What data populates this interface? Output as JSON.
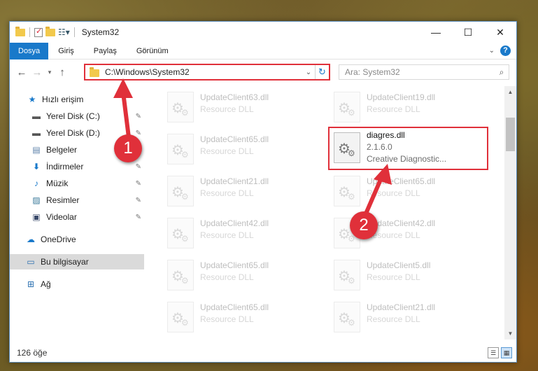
{
  "window": {
    "title": "System32",
    "controls": {
      "minimize": "—",
      "maximize": "☐",
      "close": "✕"
    }
  },
  "ribbon": {
    "tabs": [
      "Dosya",
      "Giriş",
      "Paylaş",
      "Görünüm"
    ]
  },
  "address": {
    "path": "C:\\Windows\\System32",
    "search_placeholder": "Ara: System32"
  },
  "sidebar": {
    "items": [
      {
        "label": "Hızlı erişim",
        "icon": "star-icon"
      },
      {
        "label": "Yerel Disk (C:)",
        "icon": "drive-icon",
        "pinned": true
      },
      {
        "label": "Yerel Disk (D:)",
        "icon": "drive-icon",
        "pinned": true
      },
      {
        "label": "Belgeler",
        "icon": "documents-icon",
        "pinned": true
      },
      {
        "label": "İndirmeler",
        "icon": "download-icon",
        "pinned": true
      },
      {
        "label": "Müzik",
        "icon": "music-icon",
        "pinned": true
      },
      {
        "label": "Resimler",
        "icon": "pictures-icon",
        "pinned": true
      },
      {
        "label": "Videolar",
        "icon": "videos-icon",
        "pinned": true
      },
      {
        "label": "OneDrive",
        "icon": "cloud-icon"
      },
      {
        "label": "Bu bilgisayar",
        "icon": "computer-icon",
        "selected": true
      },
      {
        "label": "Ağ",
        "icon": "network-icon"
      }
    ]
  },
  "files": {
    "left": [
      {
        "name": "UpdateClient63.dll",
        "type": "Resource DLL"
      },
      {
        "name": "UpdateClient65.dll",
        "type": "Resource DLL"
      },
      {
        "name": "UpdateClient21.dll",
        "type": "Resource DLL"
      },
      {
        "name": "UpdateClient42.dll",
        "type": "Resource DLL"
      },
      {
        "name": "UpdateClient65.dll",
        "type": "Resource DLL"
      },
      {
        "name": "UpdateClient65.dll",
        "type": "Resource DLL"
      }
    ],
    "right": [
      {
        "name": "UpdateClient19.dll",
        "type": "Resource DLL"
      },
      {
        "name": "diagres.dll",
        "version": "2.1.6.0",
        "type": "Creative Diagnostic...",
        "highlight": true
      },
      {
        "name": "UpdateClient65.dll",
        "type": "Resource DLL"
      },
      {
        "name": "UpdateClient42.dll",
        "type": "Resource DLL"
      },
      {
        "name": "UpdateClient5.dll",
        "type": "Resource DLL"
      },
      {
        "name": "UpdateClient21.dll",
        "type": "Resource DLL"
      }
    ]
  },
  "status": {
    "count": "126 öğe"
  },
  "callouts": {
    "one": "1",
    "two": "2"
  },
  "colors": {
    "accent": "#1979ca",
    "highlight": "#e0303a"
  }
}
